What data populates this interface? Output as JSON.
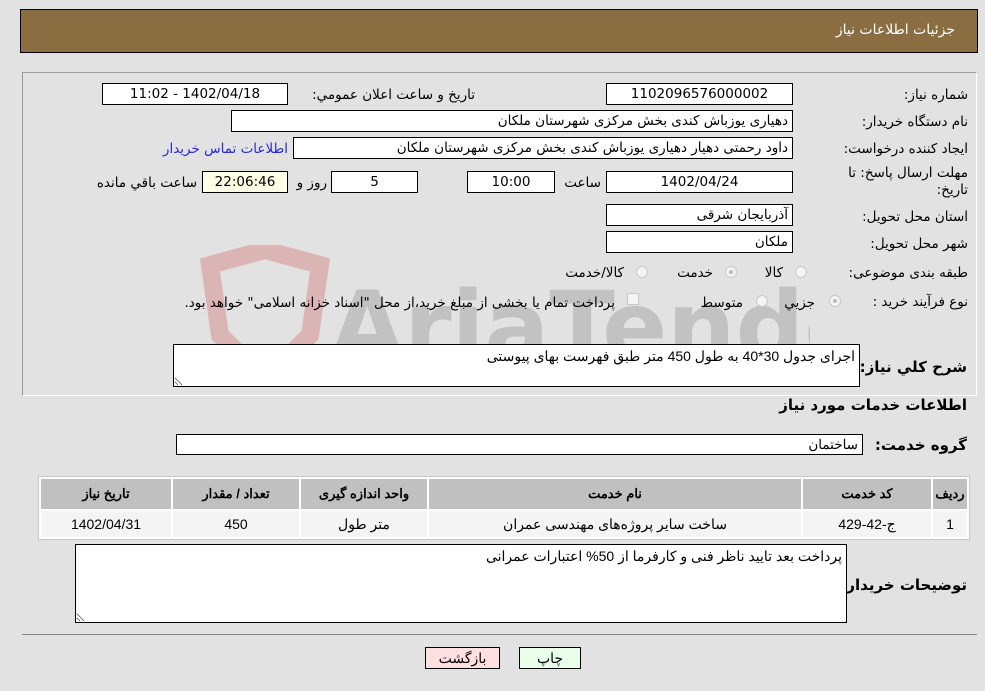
{
  "header": {
    "title": "جزئیات اطلاعات نیاز"
  },
  "fields": {
    "need_number_label": "شماره نیاز:",
    "need_number": "1102096576000002",
    "announce_label": "تاریخ و ساعت اعلان عمومي:",
    "announce_value": "1402/04/18 - 11:02",
    "buyer_org_label": "نام دستگاه خریدار:",
    "buyer_org": "دهیاری یوزباش کندی بخش مرکزی شهرستان ملکان",
    "requester_label": "ایجاد کننده درخواست:",
    "requester": "داود رحمتی دهیار دهیاری یوزباش کندی بخش مرکزی شهرستان ملکان",
    "contact_link": "اطلاعات تماس خریدار",
    "deadline_label": "مهلت ارسال پاسخ: تا تاریخ:",
    "deadline_date": "1402/04/24",
    "time_label": "ساعت",
    "deadline_time": "10:00",
    "days_value": "5",
    "days_label": "روز و",
    "remaining_time": "22:06:46",
    "remaining_label": "ساعت باقي مانده",
    "province_label": "استان محل تحویل:",
    "province": "آذربایجان شرقی",
    "city_label": "شهر محل تحویل:",
    "city": "ملکان",
    "category_label": "طبقه بندی موضوعی:",
    "category_options": [
      "کالا",
      "خدمت",
      "کالا/خدمت"
    ],
    "category_selected": "خدمت",
    "process_label": "نوع فرآیند خرید :",
    "process_options": [
      "جزیي",
      "متوسط"
    ],
    "process_selected": "جزیي",
    "treasury_note": "پرداخت تمام یا بخشی از مبلغ خرید،از محل \"اسناد خزانه اسلامی\" خواهد بود."
  },
  "description": {
    "label": "شرح کلي نیاز:",
    "value": "اجرای جدول 30*40 به طول 450 متر طبق فهرست بهای پیوستی"
  },
  "services_section": {
    "title": "اطلاعات خدمات مورد نیاز",
    "group_label": "گروه خدمت:",
    "group_value": "ساختمان"
  },
  "table": {
    "headers": [
      "ردیف",
      "کد خدمت",
      "نام خدمت",
      "واحد اندازه گیری",
      "تعداد / مقدار",
      "تاریخ نیاز"
    ],
    "rows": [
      [
        "1",
        "ج-42-429",
        "ساخت سایر پروژه‌های مهندسی عمران",
        "متر طول",
        "450",
        "1402/04/31"
      ]
    ]
  },
  "buyer_notes": {
    "label": "توضیحات خریدار:",
    "value": "پرداخت بعد تایید ناظر فنی و کارفرما از 50% اعتبارات عمرانی"
  },
  "buttons": {
    "print": "چاپ",
    "back": "بازگشت"
  },
  "watermark": {
    "text": "AriaTender.neT"
  },
  "colors": {
    "header_bg": "#8b6d42",
    "print_btn_bg": "#eaffea",
    "back_btn_bg": "#ffe0e0",
    "link": "#2a2ad0"
  }
}
